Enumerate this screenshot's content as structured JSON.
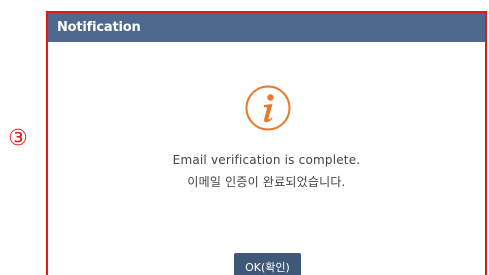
{
  "annotation": {
    "step_marker": "③",
    "accent_color": "#e01919"
  },
  "dialog": {
    "title": "Notification",
    "icon": "info-icon",
    "icon_color": "#e8792b",
    "message_en": "Email verification is complete.",
    "message_ko": "이메일 인증이 완료되었습니다.",
    "ok_label": "OK(확인)",
    "header_color": "#4d6a8e",
    "button_color": "#3f5878"
  }
}
